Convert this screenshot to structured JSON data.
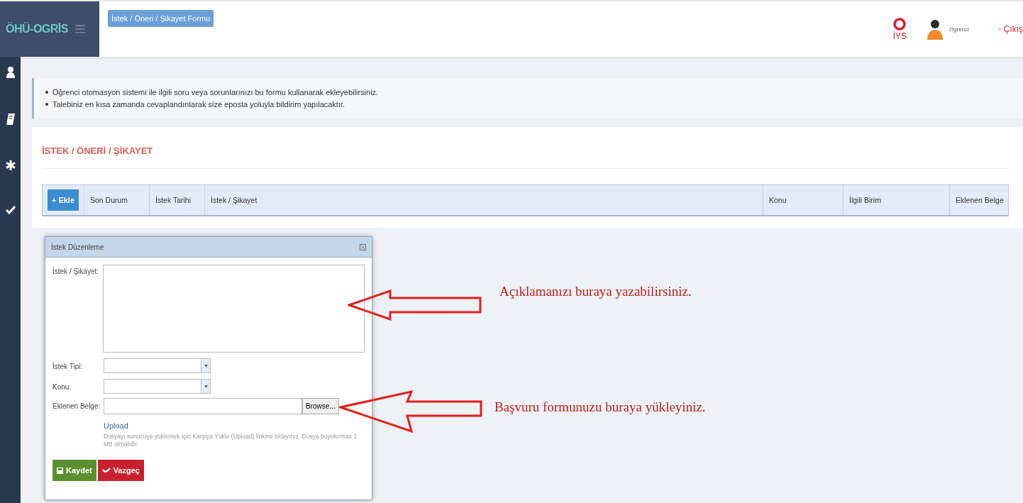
{
  "header": {
    "logo": "ÖHÜ-OGRİS",
    "breadcrumb": "İstek / Öneri / Şikayet Formu",
    "help_label": "İYS",
    "user_name": "Ogrenci",
    "logout": "Çıkış"
  },
  "info": [
    "Öğrenci otomasyon sistemi ile ilgili soru veya sorunlarınızı bu formu kullanarak ekleyebilirsiniz.",
    "Talebiniz en kısa zamanda cevaplandırılarak size eposta yoluyla bildirim yapılacaktır."
  ],
  "section_title": "İSTEK / ÖNERİ / ŞİKAYET",
  "table": {
    "add_button": "+ Ekle",
    "columns": [
      "Son Durum",
      "İstek Tarihi",
      "İstek / Şikayet",
      "Konu",
      "İlgili Birim",
      "Eklenen Belge"
    ]
  },
  "dialog": {
    "title": "İstek Düzenleme",
    "fields": [
      {
        "label": "İstek / Şikayet:",
        "kind": "textarea"
      },
      {
        "label": "İstek Tipi:",
        "kind": "select"
      },
      {
        "label": "Konu:",
        "kind": "select"
      },
      {
        "label": "Eklenen Belge:",
        "kind": "file",
        "button": "Browse..."
      }
    ],
    "upload_link": "Upload",
    "hint": "Dosyayı sunucuya yüklemek için Karşıya Yükle (Upload) linkine tıklayınız. Dosya boyutu max 2 MB olmalıdır.",
    "buttons": [
      {
        "label": "Kaydet",
        "kind": "save"
      },
      {
        "label": "Vazgeç",
        "kind": "cancel"
      }
    ]
  },
  "annotations": [
    "Açıklamanızı buraya yazabilirsiniz.",
    "Başvuru formunuzu buraya yükleyiniz."
  ]
}
